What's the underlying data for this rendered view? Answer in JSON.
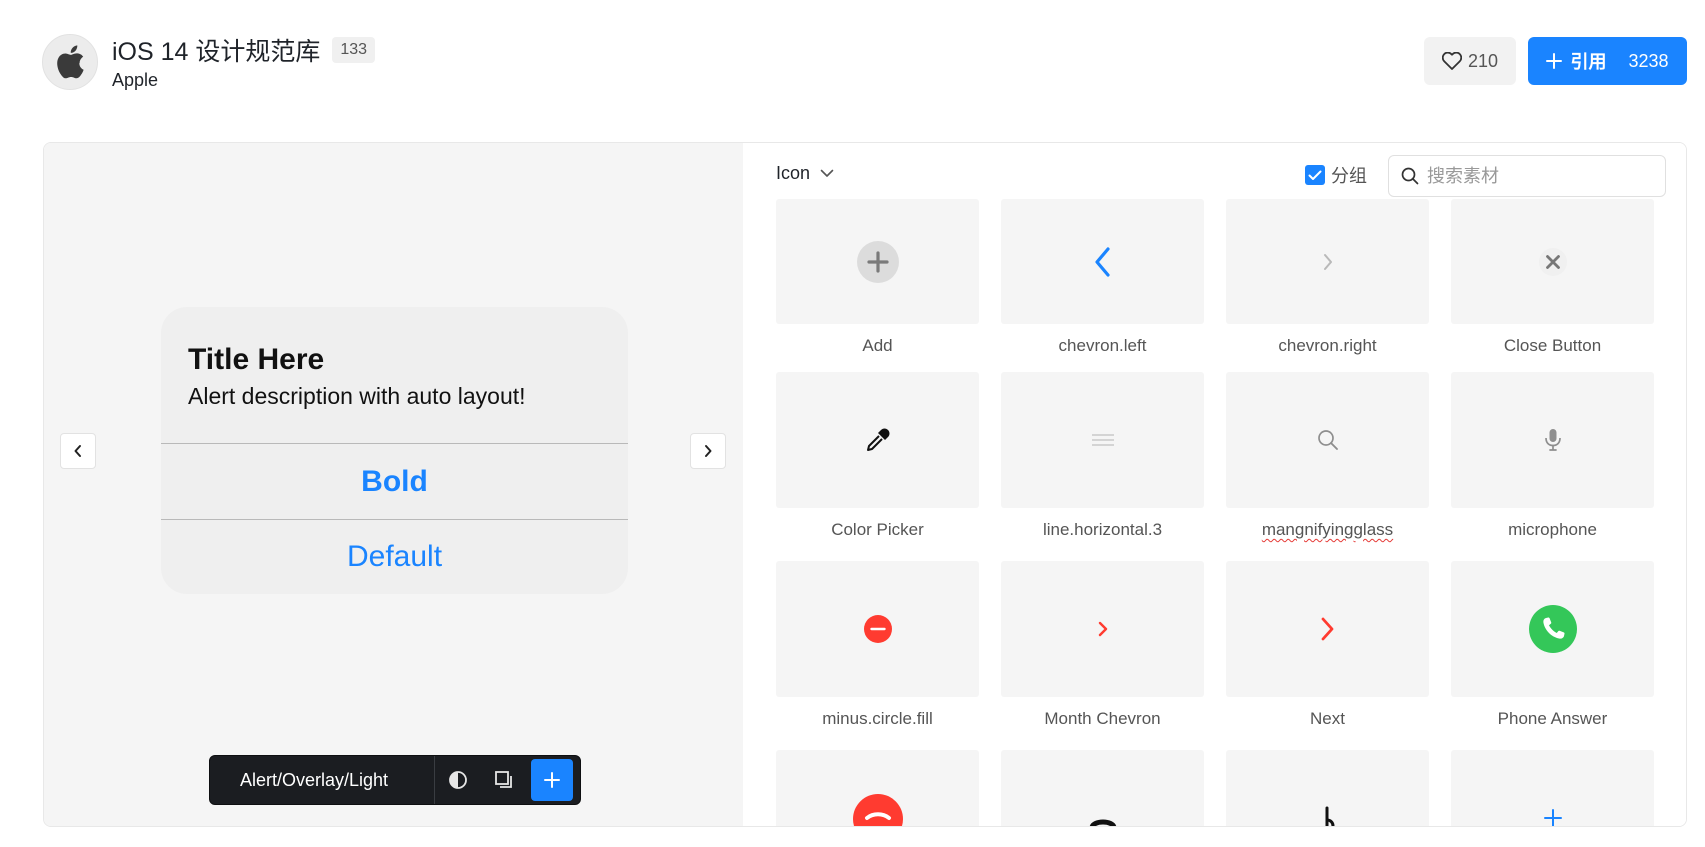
{
  "header": {
    "title": "iOS 14 设计规范库",
    "count": "133",
    "author": "Apple",
    "like_count": "210",
    "quote_label": "引用",
    "quote_count": "3238"
  },
  "preview": {
    "alert": {
      "title": "Title Here",
      "description": "Alert description with auto layout!",
      "bold_button": "Bold",
      "default_button": "Default"
    },
    "component_name": "Alert/Overlay/Light"
  },
  "panel": {
    "category": "Icon",
    "group_label": "分组",
    "group_checked": true,
    "search_placeholder": "搜索素材",
    "icons": [
      {
        "label": "Add",
        "icon": "plus-circle-icon"
      },
      {
        "label": "chevron.left",
        "icon": "chevron-left-icon"
      },
      {
        "label": "chevron.right",
        "icon": "chevron-right-icon"
      },
      {
        "label": "Close Button",
        "icon": "close-icon"
      },
      {
        "label": "Color Picker",
        "icon": "eyedropper-icon"
      },
      {
        "label": "line.horizontal.3",
        "icon": "hamburger-icon"
      },
      {
        "label": "mangnifyingglass",
        "icon": "magnifying-glass-icon"
      },
      {
        "label": "microphone",
        "icon": "microphone-icon"
      },
      {
        "label": "minus.circle.fill",
        "icon": "minus-circle-icon"
      },
      {
        "label": "Month Chevron",
        "icon": "month-chevron-icon"
      },
      {
        "label": "Next",
        "icon": "next-chevron-icon"
      },
      {
        "label": "Phone Answer",
        "icon": "phone-answer-icon"
      }
    ]
  },
  "colors": {
    "accent": "#1a84ff",
    "red": "#ff3b30",
    "green": "#34c759",
    "toolbar_bg": "#1b1d21"
  }
}
